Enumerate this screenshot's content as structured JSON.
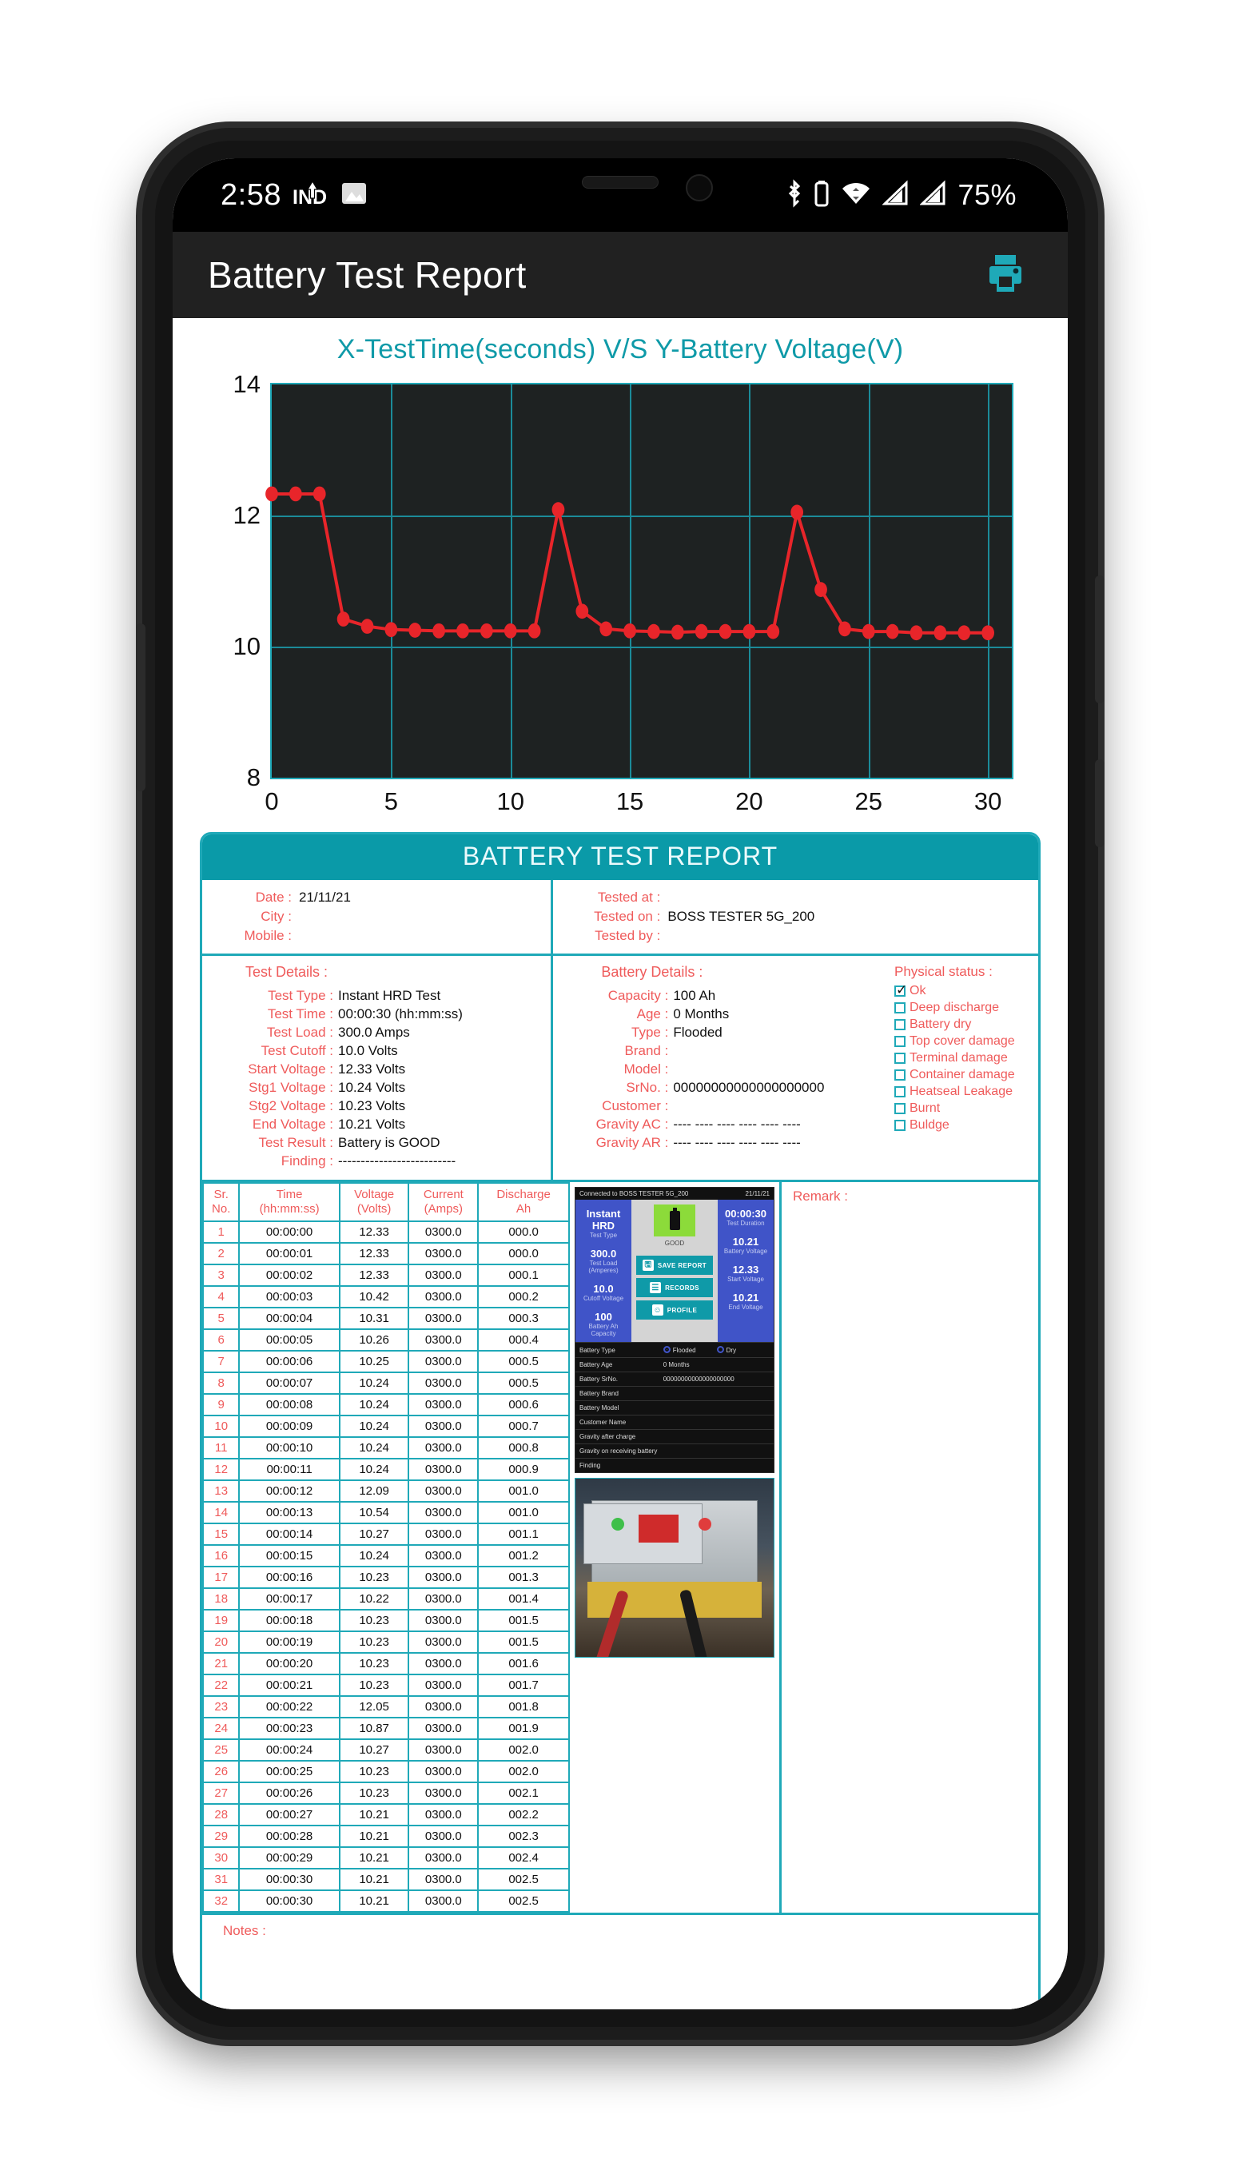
{
  "status_bar": {
    "clock": "2:58",
    "network_label": "IND",
    "icons": [
      "upload-arrow-icon",
      "image-icon",
      "bluetooth-icon",
      "battery-icon",
      "wifi-icon",
      "signal-icon",
      "signal-icon"
    ],
    "battery_percent": "75%"
  },
  "app_bar": {
    "title": "Battery Test Report",
    "print_icon": "printer-icon",
    "accent": "#1fa9b8"
  },
  "chart_data": {
    "type": "line",
    "title": "X-TestTime(seconds)  V/S  Y-Battery Voltage(V)",
    "xlabel": "TestTime(seconds)",
    "ylabel": "Battery Voltage(V)",
    "xlim": [
      0,
      31
    ],
    "ylim": [
      8,
      14
    ],
    "xticks": [
      0,
      5,
      10,
      15,
      20,
      25,
      30
    ],
    "yticks": [
      8,
      10,
      12,
      14
    ],
    "grid": true,
    "plot_bg": "#1e2222",
    "grid_color": "#1b8b99",
    "series_color": "#e8252a",
    "x": [
      0,
      1,
      2,
      3,
      4,
      5,
      6,
      7,
      8,
      9,
      10,
      11,
      12,
      13,
      14,
      15,
      16,
      17,
      18,
      19,
      20,
      21,
      22,
      23,
      24,
      25,
      26,
      27,
      28,
      29,
      30
    ],
    "values": [
      12.33,
      12.33,
      12.33,
      10.42,
      10.31,
      10.26,
      10.25,
      10.24,
      10.24,
      10.24,
      10.24,
      10.24,
      12.09,
      10.54,
      10.27,
      10.24,
      10.23,
      10.22,
      10.23,
      10.23,
      10.23,
      10.23,
      12.05,
      10.87,
      10.27,
      10.23,
      10.23,
      10.21,
      10.21,
      10.21,
      10.21
    ]
  },
  "report": {
    "banner": "BATTERY TEST REPORT",
    "meta_left": [
      {
        "key": "Date :",
        "value": "21/11/21"
      },
      {
        "key": "City :",
        "value": ""
      },
      {
        "key": "Mobile :",
        "value": ""
      }
    ],
    "meta_right": [
      {
        "key": "Tested at :",
        "value": ""
      },
      {
        "key": "Tested on :",
        "value": "BOSS TESTER 5G_200"
      },
      {
        "key": "Tested by :",
        "value": ""
      }
    ],
    "test_details_heading": "Test Details :",
    "test_details": [
      {
        "key": "Test Type :",
        "value": "Instant HRD Test"
      },
      {
        "key": "Test Time :",
        "value": "00:00:30 (hh:mm:ss)"
      },
      {
        "key": "Test Load :",
        "value": "300.0 Amps"
      },
      {
        "key": "Test Cutoff :",
        "value": "10.0 Volts"
      },
      {
        "key": "Start Voltage :",
        "value": "12.33 Volts"
      },
      {
        "key": "Stg1 Voltage :",
        "value": "10.24 Volts"
      },
      {
        "key": "Stg2 Voltage :",
        "value": "10.23 Volts"
      },
      {
        "key": "End Voltage :",
        "value": "10.21 Volts"
      },
      {
        "key": "Test Result :",
        "value": "Battery is GOOD"
      },
      {
        "key": "Finding :",
        "value": "--------------------------"
      }
    ],
    "battery_details_heading": "Battery Details :",
    "battery_details": [
      {
        "key": "Capacity :",
        "value": "100 Ah"
      },
      {
        "key": "Age :",
        "value": "0 Months"
      },
      {
        "key": "Type :",
        "value": "Flooded"
      },
      {
        "key": "Brand :",
        "value": ""
      },
      {
        "key": "Model :",
        "value": ""
      },
      {
        "key": "SrNo. :",
        "value": "00000000000000000000"
      },
      {
        "key": "Customer :",
        "value": ""
      },
      {
        "key": "Gravity AC :",
        "value": "---- ---- ---- ---- ---- ----"
      },
      {
        "key": "Gravity AR :",
        "value": "---- ---- ---- ---- ---- ----"
      }
    ],
    "physical_status_title": "Physical status :",
    "physical_status": [
      {
        "label": "Ok",
        "checked": true
      },
      {
        "label": "Deep discharge",
        "checked": false
      },
      {
        "label": "Battery dry",
        "checked": false
      },
      {
        "label": "Top cover damage",
        "checked": false
      },
      {
        "label": "Terminal damage",
        "checked": false
      },
      {
        "label": "Container damage",
        "checked": false
      },
      {
        "label": "Heatseal Leakage",
        "checked": false
      },
      {
        "label": "Burnt",
        "checked": false
      },
      {
        "label": "Buldge",
        "checked": false
      }
    ],
    "table_headers": [
      "Sr.\nNo.",
      "Time\n(hh:mm:ss)",
      "Voltage\n(Volts)",
      "Current\n(Amps)",
      "Discharge\nAh"
    ],
    "table_header_lines": [
      [
        "Sr.",
        "No."
      ],
      [
        "Time",
        "(hh:mm:ss)"
      ],
      [
        "Voltage",
        "(Volts)"
      ],
      [
        "Current",
        "(Amps)"
      ],
      [
        "Discharge",
        "Ah"
      ]
    ],
    "table_rows": [
      [
        "1",
        "00:00:00",
        "12.33",
        "0300.0",
        "000.0"
      ],
      [
        "2",
        "00:00:01",
        "12.33",
        "0300.0",
        "000.0"
      ],
      [
        "3",
        "00:00:02",
        "12.33",
        "0300.0",
        "000.1"
      ],
      [
        "4",
        "00:00:03",
        "10.42",
        "0300.0",
        "000.2"
      ],
      [
        "5",
        "00:00:04",
        "10.31",
        "0300.0",
        "000.3"
      ],
      [
        "6",
        "00:00:05",
        "10.26",
        "0300.0",
        "000.4"
      ],
      [
        "7",
        "00:00:06",
        "10.25",
        "0300.0",
        "000.5"
      ],
      [
        "8",
        "00:00:07",
        "10.24",
        "0300.0",
        "000.5"
      ],
      [
        "9",
        "00:00:08",
        "10.24",
        "0300.0",
        "000.6"
      ],
      [
        "10",
        "00:00:09",
        "10.24",
        "0300.0",
        "000.7"
      ],
      [
        "11",
        "00:00:10",
        "10.24",
        "0300.0",
        "000.8"
      ],
      [
        "12",
        "00:00:11",
        "10.24",
        "0300.0",
        "000.9"
      ],
      [
        "13",
        "00:00:12",
        "12.09",
        "0300.0",
        "001.0"
      ],
      [
        "14",
        "00:00:13",
        "10.54",
        "0300.0",
        "001.0"
      ],
      [
        "15",
        "00:00:14",
        "10.27",
        "0300.0",
        "001.1"
      ],
      [
        "16",
        "00:00:15",
        "10.24",
        "0300.0",
        "001.2"
      ],
      [
        "17",
        "00:00:16",
        "10.23",
        "0300.0",
        "001.3"
      ],
      [
        "18",
        "00:00:17",
        "10.22",
        "0300.0",
        "001.4"
      ],
      [
        "19",
        "00:00:18",
        "10.23",
        "0300.0",
        "001.5"
      ],
      [
        "20",
        "00:00:19",
        "10.23",
        "0300.0",
        "001.5"
      ],
      [
        "21",
        "00:00:20",
        "10.23",
        "0300.0",
        "001.6"
      ],
      [
        "22",
        "00:00:21",
        "10.23",
        "0300.0",
        "001.7"
      ],
      [
        "23",
        "00:00:22",
        "12.05",
        "0300.0",
        "001.8"
      ],
      [
        "24",
        "00:00:23",
        "10.87",
        "0300.0",
        "001.9"
      ],
      [
        "25",
        "00:00:24",
        "10.27",
        "0300.0",
        "002.0"
      ],
      [
        "26",
        "00:00:25",
        "10.23",
        "0300.0",
        "002.0"
      ],
      [
        "27",
        "00:00:26",
        "10.23",
        "0300.0",
        "002.1"
      ],
      [
        "28",
        "00:00:27",
        "10.21",
        "0300.0",
        "002.2"
      ],
      [
        "29",
        "00:00:28",
        "10.21",
        "0300.0",
        "002.3"
      ],
      [
        "30",
        "00:00:29",
        "10.21",
        "0300.0",
        "002.4"
      ],
      [
        "31",
        "00:00:30",
        "10.21",
        "0300.0",
        "002.5"
      ],
      [
        "32",
        "00:00:30",
        "10.21",
        "0300.0",
        "002.5"
      ]
    ],
    "remark_label": "Remark :",
    "notes_label": "Notes :"
  },
  "app_screenshot": {
    "connected_text": "Connected to BOSS TESTER 5G_200",
    "date_text": "21/11/21",
    "left": [
      {
        "big": "Instant HRD",
        "sml": "Test Type"
      },
      {
        "big": "300.0",
        "sml": "Test Load (Amperes)"
      },
      {
        "big": "10.0",
        "sml": "Cutoff Voltage"
      },
      {
        "big": "100",
        "sml": "Battery Ah Capacity"
      }
    ],
    "mid_status": "GOOD",
    "mid_buttons": [
      {
        "label": "SAVE REPORT",
        "icon": "save-icon",
        "glyph": "🖫"
      },
      {
        "label": "RECORDS",
        "icon": "list-icon",
        "glyph": "☰"
      },
      {
        "label": "PROFILE",
        "icon": "profile-icon",
        "glyph": "☺"
      }
    ],
    "right": [
      {
        "big": "00:00:30",
        "sml": "Test Duration"
      },
      {
        "big": "10.21",
        "sml": "Battery Voltage"
      },
      {
        "big": "12.33",
        "sml": "Start Voltage"
      },
      {
        "big": "10.21",
        "sml": "End Voltage"
      }
    ],
    "rows": [
      {
        "a": "Battery Type",
        "b": "radio:Flooded|Dry"
      },
      {
        "a": "Battery Age",
        "b": "0          Months"
      },
      {
        "a": "Battery SrNo.",
        "b": "00000000000000000000"
      },
      {
        "a": "Battery Brand",
        "b": ""
      },
      {
        "a": "Battery Model",
        "b": ""
      },
      {
        "a": "Customer Name",
        "b": ""
      },
      {
        "a": "Gravity after charge",
        "b": ""
      },
      {
        "a": "Gravity on receiving battery",
        "b": ""
      },
      {
        "a": "Finding",
        "b": ""
      }
    ]
  }
}
